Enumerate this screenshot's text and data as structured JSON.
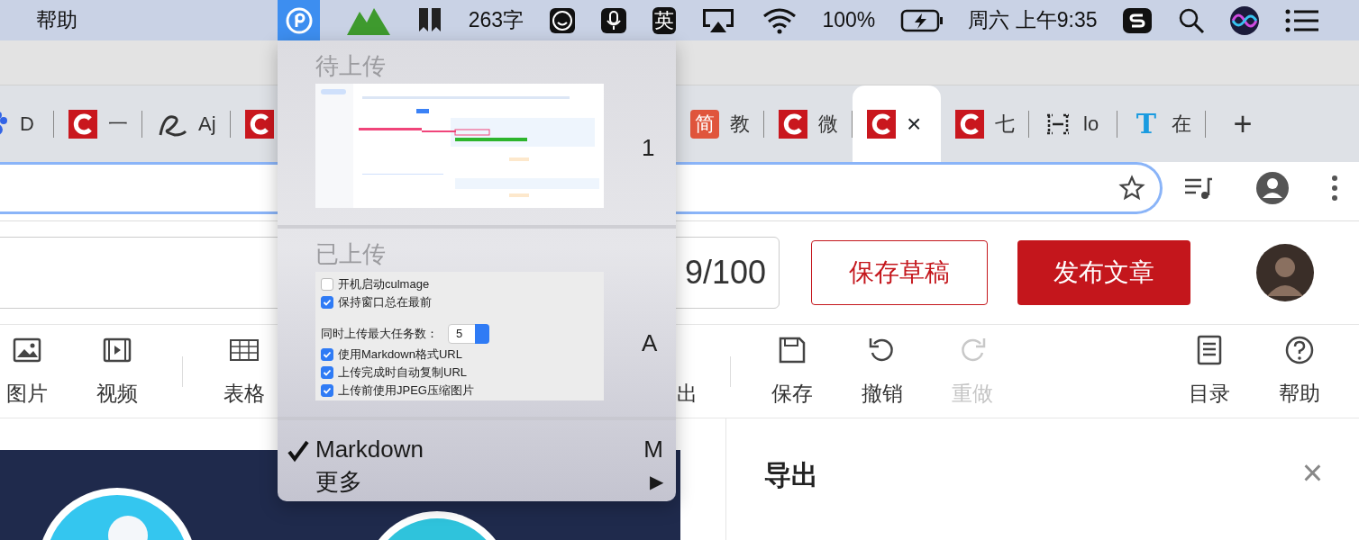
{
  "menu_bar": {
    "app_menu": "帮助",
    "word_count": "263字",
    "input_method": "英",
    "battery": "100%",
    "clock": "周六 上午9:35"
  },
  "tabs": [
    {
      "kind": "paw",
      "label": "D",
      "selected": false
    },
    {
      "kind": "clogo",
      "label": "一",
      "selected": false
    },
    {
      "kind": "swirl",
      "label": "Aj",
      "selected": false
    },
    {
      "kind": "clogo",
      "selected": false
    },
    {
      "kind": "lettered",
      "favicon_text": "简",
      "label": "教",
      "selected": false
    },
    {
      "kind": "clogo",
      "label": "微",
      "selected": false
    },
    {
      "kind": "clogo",
      "close": "×",
      "selected": true
    },
    {
      "kind": "clogo",
      "label": "七",
      "selected": false
    },
    {
      "kind": "bracket",
      "label": "lo",
      "selected": false
    },
    {
      "kind": "lettered",
      "favicon_text": "T",
      "label": "在",
      "selected": false
    }
  ],
  "new_tab": "+",
  "editor": {
    "title_counter": "9/100",
    "buttons": [
      {
        "label": "保存草稿",
        "kind": "outline"
      },
      {
        "label": "发布文章",
        "kind": "primary"
      }
    ],
    "toolbar": [
      {
        "items": [
          {
            "label": "图片",
            "disabled": false
          },
          {
            "label": "视频",
            "disabled": false
          }
        ]
      },
      {
        "items": [
          {
            "label": "表格",
            "disabled": false
          }
        ]
      },
      {
        "items": [
          {
            "label": "出",
            "disabled": false
          }
        ]
      },
      {
        "items": [
          {
            "label": "保存",
            "disabled": false
          },
          {
            "label": "撤销",
            "disabled": false
          },
          {
            "label": "重做",
            "disabled": true
          }
        ]
      },
      {
        "items": [
          {
            "label": "目录",
            "disabled": false
          },
          {
            "label": "帮助",
            "disabled": false
          }
        ]
      }
    ],
    "side_panel": {
      "title": "导出",
      "close": "×"
    }
  },
  "upload_menu": {
    "sections": [
      {
        "title": "待上传",
        "shortcut": "1",
        "kind": "thumbnail"
      },
      {
        "title": "已上传",
        "shortcut": "A",
        "kind": "settings",
        "settings": [
          {
            "kind": "checkbox",
            "label": "开机启动culmage",
            "checked": false
          },
          {
            "kind": "checkbox",
            "label": "保持窗口总在最前",
            "checked": true
          },
          {
            "kind": "stepper",
            "label": "同时上传最大任务数：",
            "value": "5"
          },
          {
            "kind": "checkbox",
            "label": "使用Markdown格式URL",
            "checked": true
          },
          {
            "kind": "checkbox",
            "label": "上传完成时自动复制URL",
            "checked": true
          },
          {
            "kind": "checkbox",
            "label": "上传前使用JPEG压缩图片",
            "checked": true
          }
        ]
      }
    ],
    "items": [
      {
        "label": "Markdown",
        "shortcut": "M",
        "checked": true,
        "submenu": false
      },
      {
        "label": "更多",
        "submenu": true,
        "checked": false,
        "arrow": "▶"
      }
    ]
  }
}
